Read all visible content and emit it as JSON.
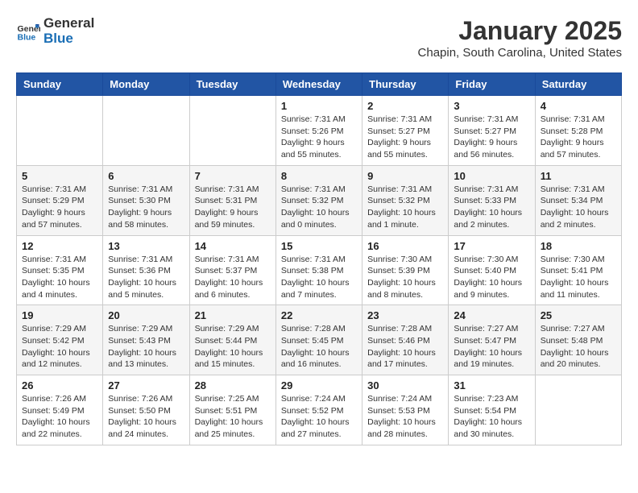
{
  "header": {
    "logo_line1": "General",
    "logo_line2": "Blue",
    "month": "January 2025",
    "location": "Chapin, South Carolina, United States"
  },
  "weekdays": [
    "Sunday",
    "Monday",
    "Tuesday",
    "Wednesday",
    "Thursday",
    "Friday",
    "Saturday"
  ],
  "weeks": [
    [
      {
        "day": "",
        "info": ""
      },
      {
        "day": "",
        "info": ""
      },
      {
        "day": "",
        "info": ""
      },
      {
        "day": "1",
        "info": "Sunrise: 7:31 AM\nSunset: 5:26 PM\nDaylight: 9 hours\nand 55 minutes."
      },
      {
        "day": "2",
        "info": "Sunrise: 7:31 AM\nSunset: 5:27 PM\nDaylight: 9 hours\nand 55 minutes."
      },
      {
        "day": "3",
        "info": "Sunrise: 7:31 AM\nSunset: 5:27 PM\nDaylight: 9 hours\nand 56 minutes."
      },
      {
        "day": "4",
        "info": "Sunrise: 7:31 AM\nSunset: 5:28 PM\nDaylight: 9 hours\nand 57 minutes."
      }
    ],
    [
      {
        "day": "5",
        "info": "Sunrise: 7:31 AM\nSunset: 5:29 PM\nDaylight: 9 hours\nand 57 minutes."
      },
      {
        "day": "6",
        "info": "Sunrise: 7:31 AM\nSunset: 5:30 PM\nDaylight: 9 hours\nand 58 minutes."
      },
      {
        "day": "7",
        "info": "Sunrise: 7:31 AM\nSunset: 5:31 PM\nDaylight: 9 hours\nand 59 minutes."
      },
      {
        "day": "8",
        "info": "Sunrise: 7:31 AM\nSunset: 5:32 PM\nDaylight: 10 hours\nand 0 minutes."
      },
      {
        "day": "9",
        "info": "Sunrise: 7:31 AM\nSunset: 5:32 PM\nDaylight: 10 hours\nand 1 minute."
      },
      {
        "day": "10",
        "info": "Sunrise: 7:31 AM\nSunset: 5:33 PM\nDaylight: 10 hours\nand 2 minutes."
      },
      {
        "day": "11",
        "info": "Sunrise: 7:31 AM\nSunset: 5:34 PM\nDaylight: 10 hours\nand 2 minutes."
      }
    ],
    [
      {
        "day": "12",
        "info": "Sunrise: 7:31 AM\nSunset: 5:35 PM\nDaylight: 10 hours\nand 4 minutes."
      },
      {
        "day": "13",
        "info": "Sunrise: 7:31 AM\nSunset: 5:36 PM\nDaylight: 10 hours\nand 5 minutes."
      },
      {
        "day": "14",
        "info": "Sunrise: 7:31 AM\nSunset: 5:37 PM\nDaylight: 10 hours\nand 6 minutes."
      },
      {
        "day": "15",
        "info": "Sunrise: 7:31 AM\nSunset: 5:38 PM\nDaylight: 10 hours\nand 7 minutes."
      },
      {
        "day": "16",
        "info": "Sunrise: 7:30 AM\nSunset: 5:39 PM\nDaylight: 10 hours\nand 8 minutes."
      },
      {
        "day": "17",
        "info": "Sunrise: 7:30 AM\nSunset: 5:40 PM\nDaylight: 10 hours\nand 9 minutes."
      },
      {
        "day": "18",
        "info": "Sunrise: 7:30 AM\nSunset: 5:41 PM\nDaylight: 10 hours\nand 11 minutes."
      }
    ],
    [
      {
        "day": "19",
        "info": "Sunrise: 7:29 AM\nSunset: 5:42 PM\nDaylight: 10 hours\nand 12 minutes."
      },
      {
        "day": "20",
        "info": "Sunrise: 7:29 AM\nSunset: 5:43 PM\nDaylight: 10 hours\nand 13 minutes."
      },
      {
        "day": "21",
        "info": "Sunrise: 7:29 AM\nSunset: 5:44 PM\nDaylight: 10 hours\nand 15 minutes."
      },
      {
        "day": "22",
        "info": "Sunrise: 7:28 AM\nSunset: 5:45 PM\nDaylight: 10 hours\nand 16 minutes."
      },
      {
        "day": "23",
        "info": "Sunrise: 7:28 AM\nSunset: 5:46 PM\nDaylight: 10 hours\nand 17 minutes."
      },
      {
        "day": "24",
        "info": "Sunrise: 7:27 AM\nSunset: 5:47 PM\nDaylight: 10 hours\nand 19 minutes."
      },
      {
        "day": "25",
        "info": "Sunrise: 7:27 AM\nSunset: 5:48 PM\nDaylight: 10 hours\nand 20 minutes."
      }
    ],
    [
      {
        "day": "26",
        "info": "Sunrise: 7:26 AM\nSunset: 5:49 PM\nDaylight: 10 hours\nand 22 minutes."
      },
      {
        "day": "27",
        "info": "Sunrise: 7:26 AM\nSunset: 5:50 PM\nDaylight: 10 hours\nand 24 minutes."
      },
      {
        "day": "28",
        "info": "Sunrise: 7:25 AM\nSunset: 5:51 PM\nDaylight: 10 hours\nand 25 minutes."
      },
      {
        "day": "29",
        "info": "Sunrise: 7:24 AM\nSunset: 5:52 PM\nDaylight: 10 hours\nand 27 minutes."
      },
      {
        "day": "30",
        "info": "Sunrise: 7:24 AM\nSunset: 5:53 PM\nDaylight: 10 hours\nand 28 minutes."
      },
      {
        "day": "31",
        "info": "Sunrise: 7:23 AM\nSunset: 5:54 PM\nDaylight: 10 hours\nand 30 minutes."
      },
      {
        "day": "",
        "info": ""
      }
    ]
  ]
}
